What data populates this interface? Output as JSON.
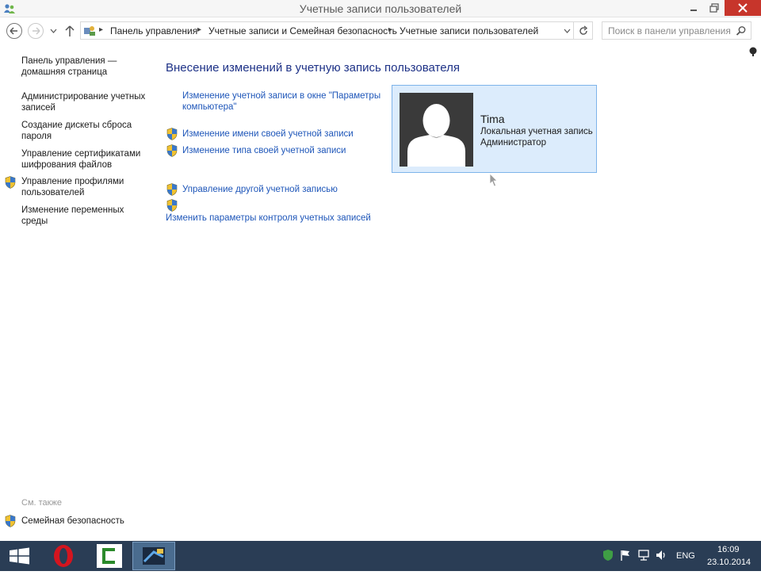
{
  "window": {
    "title": "Учетные записи пользователей"
  },
  "address_bar": {
    "crumbs": [
      "Панель управления",
      "Учетные записи и Семейная безопасность",
      "Учетные записи пользователей"
    ],
    "search_placeholder": "Поиск в панели управления"
  },
  "sidebar": {
    "home": [
      "Панель управления —",
      "домашняя страница"
    ],
    "items": [
      {
        "lines": [
          "Администрирование учетных",
          "записей"
        ],
        "shield": false
      },
      {
        "lines": [
          "Создание дискеты сброса",
          "пароля"
        ],
        "shield": false
      },
      {
        "lines": [
          "Управление сертификатами",
          "шифрования файлов"
        ],
        "shield": false
      },
      {
        "lines": [
          "Управление профилями",
          "пользователей"
        ],
        "shield": true
      },
      {
        "lines": [
          "Изменение переменных",
          "среды"
        ],
        "shield": false
      }
    ],
    "see_also": "См. также",
    "family_safety": "Семейная безопасность"
  },
  "main": {
    "heading": "Внесение изменений в учетную запись пользователя",
    "links": [
      {
        "lines": [
          "Изменение учетной записи в окне \"Параметры",
          "компьютера\""
        ],
        "shield": false
      },
      {
        "lines": [
          "Изменение имени своей учетной записи"
        ],
        "shield": true
      },
      {
        "lines": [
          "Изменение типа своей учетной записи"
        ],
        "shield": true
      },
      {
        "lines": [
          "Управление другой учетной записью"
        ],
        "shield": true
      },
      {
        "lines": [
          "Изменить параметры контроля учетных записей"
        ],
        "shield": true
      }
    ],
    "user": {
      "name": "Tima",
      "type": "Локальная учетная запись",
      "role": "Администратор"
    }
  },
  "taskbar": {
    "apps": [
      "opera-icon",
      "camtasia-icon",
      "control-panel-icon"
    ],
    "language": "ENG",
    "time": "16:09",
    "date": "23.10.2014"
  },
  "colors": {
    "link": "#1e56b9",
    "heading": "#1e3287",
    "card_bg": "#dcecfc",
    "card_border": "#7eb4ea",
    "taskbar": "#2a3d55",
    "close": "#c7352b"
  }
}
